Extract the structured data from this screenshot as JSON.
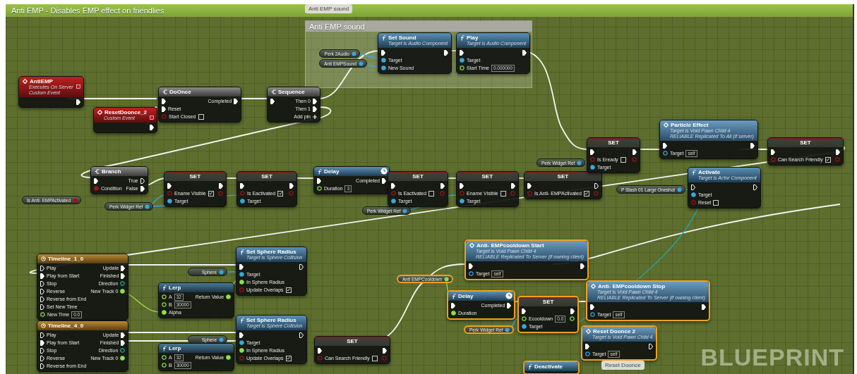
{
  "graph_comment": "Anti EMP - Disables EMP effect on friendlies",
  "bubbles": [
    {
      "text": "Anti EMP sound"
    },
    {
      "text": "Reset Doonce"
    }
  ],
  "comments": [
    {
      "title": "Anti EMP sound"
    }
  ],
  "nodes": [
    {
      "kind": "event",
      "title": "AntiEMP",
      "subtitle": [
        "Executes On Server",
        "Custom Event"
      ],
      "selected": false,
      "outputs": [
        {
          "kind": "exec",
          "linked": true
        }
      ]
    },
    {
      "kind": "event",
      "title": "ResetDoonce_2",
      "subtitle": [
        "Custom Event"
      ],
      "selected": false,
      "outputs": [
        {
          "kind": "exec",
          "linked": true
        }
      ]
    },
    {
      "kind": "flow",
      "title": "DoOnce",
      "selected": false,
      "inputs": [
        {
          "kind": "exec",
          "linked": true
        },
        {
          "kind": "exec",
          "label": "Reset",
          "linked": true
        },
        {
          "kind": "bool",
          "label": "Start Closed",
          "checked": false,
          "linked": false
        }
      ],
      "outputs": [
        {
          "kind": "exec",
          "label": "Completed",
          "linked": true
        }
      ]
    },
    {
      "kind": "flow",
      "title": "Sequence",
      "selected": false,
      "inputs": [
        {
          "kind": "exec",
          "linked": true
        }
      ],
      "outputs": [
        {
          "kind": "exec",
          "label": "Then 0",
          "linked": true
        },
        {
          "kind": "exec",
          "label": "Then 1",
          "linked": true
        },
        {
          "kind": "add",
          "label": "Add pin",
          "linked": false
        }
      ]
    },
    {
      "kind": "variable",
      "title": "Perk 2Audio",
      "color": "#38a8e0",
      "selected": false
    },
    {
      "kind": "variable",
      "title": "Anti EMPSound",
      "color": "#38a8e0",
      "selected": false
    },
    {
      "kind": "function",
      "title": "Set Sound",
      "subtitle": [
        "Target is Audio Component"
      ],
      "selected": false,
      "latent": false,
      "inputs": [
        {
          "kind": "exec",
          "linked": true
        },
        {
          "kind": "object",
          "label": "Target",
          "linked": true
        },
        {
          "kind": "object",
          "label": "New Sound",
          "linked": true
        }
      ],
      "outputs": [
        {
          "kind": "exec",
          "linked": true
        }
      ]
    },
    {
      "kind": "function",
      "title": "Play",
      "subtitle": [
        "Target is Audio Component"
      ],
      "selected": false,
      "latent": false,
      "inputs": [
        {
          "kind": "exec",
          "linked": true
        },
        {
          "kind": "object",
          "label": "Target",
          "linked": true
        },
        {
          "kind": "float",
          "label": "Start Time",
          "value": "0.000000",
          "linked": false
        }
      ],
      "outputs": [
        {
          "kind": "exec",
          "linked": true
        }
      ]
    },
    {
      "kind": "variable",
      "title": "Is Anti- EMPActivated",
      "color": "#a01414",
      "selected": false
    },
    {
      "kind": "flow",
      "title": "Branch",
      "selected": false,
      "inputs": [
        {
          "kind": "exec",
          "linked": true
        },
        {
          "kind": "bool",
          "label": "Condition",
          "linked": true
        }
      ],
      "outputs": [
        {
          "kind": "exec",
          "label": "True",
          "linked": false
        },
        {
          "kind": "exec",
          "label": "False",
          "linked": true
        }
      ]
    },
    {
      "kind": "variable",
      "title": "Perk Widget Ref",
      "color": "#38a8e0",
      "selected": false
    },
    {
      "kind": "set",
      "title": "SET",
      "selected": false,
      "inputs": [
        {
          "kind": "exec",
          "linked": true
        },
        {
          "kind": "bool",
          "label": "Ename Visible",
          "checked": true,
          "linked": false
        },
        {
          "kind": "object",
          "label": "Target",
          "linked": true
        }
      ],
      "outputs": [
        {
          "kind": "exec",
          "linked": true
        },
        {
          "kind": "bool",
          "linked": false
        }
      ]
    },
    {
      "kind": "set",
      "title": "SET",
      "selected": false,
      "inputs": [
        {
          "kind": "exec",
          "linked": true
        },
        {
          "kind": "bool",
          "label": "Is Eactivated",
          "checked": true,
          "linked": false
        },
        {
          "kind": "object",
          "label": "Target",
          "linked": true
        }
      ],
      "outputs": [
        {
          "kind": "exec",
          "linked": true
        },
        {
          "kind": "bool",
          "linked": false
        }
      ]
    },
    {
      "kind": "function",
      "title": "Delay",
      "selected": false,
      "latent": true,
      "inputs": [
        {
          "kind": "exec",
          "linked": true
        },
        {
          "kind": "float",
          "label": "Duration",
          "value": "3",
          "linked": false
        }
      ],
      "outputs": [
        {
          "kind": "exec",
          "label": "Completed",
          "linked": true
        }
      ]
    },
    {
      "kind": "variable",
      "title": "Perk Widget Ref",
      "color": "#38a8e0",
      "selected": false
    },
    {
      "kind": "set",
      "title": "SET",
      "selected": false,
      "inputs": [
        {
          "kind": "exec",
          "linked": true
        },
        {
          "kind": "bool",
          "label": "Is Eactivated",
          "checked": false,
          "linked": false
        },
        {
          "kind": "object",
          "label": "Target",
          "linked": true
        }
      ],
      "outputs": [
        {
          "kind": "exec",
          "linked": true
        },
        {
          "kind": "bool",
          "linked": false
        }
      ]
    },
    {
      "kind": "set",
      "title": "SET",
      "selected": false,
      "inputs": [
        {
          "kind": "exec",
          "linked": true
        },
        {
          "kind": "bool",
          "label": "Ename Visible",
          "checked": false,
          "linked": false
        },
        {
          "kind": "object",
          "label": "Target",
          "linked": true
        }
      ],
      "outputs": [
        {
          "kind": "exec",
          "linked": true
        },
        {
          "kind": "bool",
          "linked": false
        }
      ]
    },
    {
      "kind": "variable",
      "title": "Perk Widget Ref",
      "color": "#38a8e0",
      "selected": false
    },
    {
      "kind": "set",
      "title": "SET",
      "selected": false,
      "inputs": [
        {
          "kind": "exec",
          "linked": true
        },
        {
          "kind": "bool",
          "label": "Is Anti- EMPActivated",
          "checked": true,
          "linked": false
        }
      ],
      "outputs": [
        {
          "kind": "exec",
          "linked": false
        },
        {
          "kind": "bool",
          "linked": false
        }
      ]
    },
    {
      "kind": "set",
      "title": "SET",
      "selected": false,
      "inputs": [
        {
          "kind": "exec",
          "linked": true
        },
        {
          "kind": "bool",
          "label": "Is Eready",
          "checked": false,
          "linked": false
        },
        {
          "kind": "object",
          "label": "Target",
          "linked": true
        }
      ],
      "outputs": [
        {
          "kind": "exec",
          "linked": true
        },
        {
          "kind": "bool",
          "linked": false
        }
      ]
    },
    {
      "kind": "variable",
      "title": "P Slash 01 Large Oneshot",
      "color": "#38a8e0",
      "selected": false
    },
    {
      "kind": "customcall",
      "title": "Particle Effect",
      "subtitle": [
        "Target is Void Pawn Child 4",
        "RELIABLE Replicated To All (if server)"
      ],
      "selected": false,
      "inputs": [
        {
          "kind": "exec",
          "linked": true
        },
        {
          "kind": "object",
          "label": "Target",
          "value": "self",
          "linked": false
        }
      ],
      "outputs": [
        {
          "kind": "exec",
          "linked": true
        }
      ]
    },
    {
      "kind": "function",
      "title": "Activate",
      "subtitle": [
        "Target is Actor Component"
      ],
      "selected": false,
      "latent": false,
      "inputs": [
        {
          "kind": "exec",
          "linked": false
        },
        {
          "kind": "object",
          "label": "Target",
          "linked": true
        },
        {
          "kind": "bool",
          "label": "Reset",
          "checked": false,
          "linked": false
        }
      ],
      "outputs": [
        {
          "kind": "exec",
          "linked": false
        }
      ]
    },
    {
      "kind": "set",
      "title": "SET",
      "selected": false,
      "inputs": [
        {
          "kind": "exec",
          "linked": true
        },
        {
          "kind": "bool",
          "label": "Can Search Friendly",
          "checked": true,
          "linked": false
        }
      ],
      "outputs": [
        {
          "kind": "exec",
          "linked": true
        },
        {
          "kind": "bool",
          "linked": false
        }
      ]
    },
    {
      "kind": "timeline",
      "title": "Timeline_1_0",
      "selected": false,
      "inputs": [
        {
          "kind": "exec",
          "label": "Play",
          "linked": false
        },
        {
          "kind": "exec",
          "label": "Play from Start",
          "linked": true
        },
        {
          "kind": "exec",
          "label": "Stop",
          "linked": false
        },
        {
          "kind": "exec",
          "label": "Reverse",
          "linked": false
        },
        {
          "kind": "exec",
          "label": "Reverse from End",
          "linked": false
        },
        {
          "kind": "exec",
          "label": "Set New Time",
          "linked": false
        },
        {
          "kind": "float",
          "label": "New Time",
          "value": "0.0",
          "linked": false
        }
      ],
      "outputs": [
        {
          "kind": "exec",
          "label": "Update",
          "linked": true
        },
        {
          "kind": "exec",
          "label": "Finished",
          "linked": true
        },
        {
          "kind": "enum",
          "label": "Direction",
          "linked": false
        },
        {
          "kind": "float",
          "label": "New Track 0",
          "linked": true
        }
      ]
    },
    {
      "kind": "timeline",
      "title": "Timeline_4_0",
      "selected": false,
      "inputs": [
        {
          "kind": "exec",
          "label": "Play",
          "linked": false
        },
        {
          "kind": "exec",
          "label": "Play from Start",
          "linked": true
        },
        {
          "kind": "exec",
          "label": "Stop",
          "linked": false
        },
        {
          "kind": "exec",
          "label": "Reverse",
          "linked": false
        },
        {
          "kind": "exec",
          "label": "Reverse from End",
          "linked": false
        }
      ],
      "outputs": [
        {
          "kind": "exec",
          "label": "Update",
          "linked": true
        },
        {
          "kind": "exec",
          "label": "Finished",
          "linked": true
        },
        {
          "kind": "enum",
          "label": "Direction",
          "linked": false
        },
        {
          "kind": "float",
          "label": "New Track 0",
          "linked": true
        }
      ]
    },
    {
      "kind": "variable",
      "title": "Sphere",
      "color": "#38a8e0",
      "selected": false
    },
    {
      "kind": "pure",
      "title": "Lerp",
      "selected": false,
      "inputs": [
        {
          "kind": "float",
          "label": "A",
          "value": "32",
          "linked": false
        },
        {
          "kind": "float",
          "label": "B",
          "value": "30000",
          "linked": false
        },
        {
          "kind": "float",
          "label": "Alpha",
          "linked": true
        }
      ],
      "outputs": [
        {
          "kind": "float",
          "label": "Return Value",
          "linked": true
        }
      ]
    },
    {
      "kind": "variable",
      "title": "Sphere",
      "color": "#38a8e0",
      "selected": false
    },
    {
      "kind": "pure",
      "title": "Lerp",
      "selected": false,
      "inputs": [
        {
          "kind": "float",
          "label": "A",
          "value": "32",
          "linked": false
        },
        {
          "kind": "float",
          "label": "B",
          "value": "30000",
          "linked": false
        }
      ],
      "outputs": [
        {
          "kind": "float",
          "label": "Return Value",
          "linked": true
        }
      ]
    },
    {
      "kind": "function",
      "title": "Set Sphere Radius",
      "subtitle": [
        "Target is Sphere Collision"
      ],
      "selected": false,
      "latent": false,
      "inputs": [
        {
          "kind": "exec",
          "linked": true
        },
        {
          "kind": "object",
          "label": "Target",
          "linked": true
        },
        {
          "kind": "float",
          "label": "In Sphere Radius",
          "linked": true
        },
        {
          "kind": "bool",
          "label": "Update Overlaps",
          "checked": true,
          "linked": false
        }
      ],
      "outputs": [
        {
          "kind": "exec",
          "linked": false
        }
      ]
    },
    {
      "kind": "function",
      "title": "Set Sphere Radius",
      "subtitle": [
        "Target is Sphere Collision"
      ],
      "selected": false,
      "latent": false,
      "inputs": [
        {
          "kind": "exec",
          "linked": true
        },
        {
          "kind": "object",
          "label": "Target",
          "linked": true
        },
        {
          "kind": "float",
          "label": "In Sphere Radius",
          "linked": true
        },
        {
          "kind": "bool",
          "label": "Update Overlaps",
          "checked": true,
          "linked": false
        }
      ],
      "outputs": [
        {
          "kind": "exec",
          "linked": false
        }
      ]
    },
    {
      "kind": "set",
      "title": "SET",
      "selected": false,
      "inputs": [
        {
          "kind": "exec",
          "linked": true
        },
        {
          "kind": "bool",
          "label": "Can Search Friendly",
          "checked": false,
          "linked": false
        }
      ],
      "outputs": [
        {
          "kind": "exec",
          "linked": true
        },
        {
          "kind": "bool",
          "linked": false
        }
      ]
    },
    {
      "kind": "variable",
      "title": "Anti EMPCooldown",
      "color": "#8ee04a",
      "selected": true
    },
    {
      "kind": "customcall",
      "title": "Anti- EMPcooldown Start",
      "subtitle": [
        "Target is Void Pawn Child 4",
        "RELIABLE Replicated To Server (if owning client)"
      ],
      "selected": true,
      "inputs": [
        {
          "kind": "exec",
          "linked": true
        },
        {
          "kind": "object",
          "label": "Target",
          "value": "self",
          "linked": false
        }
      ],
      "outputs": [
        {
          "kind": "exec",
          "linked": true
        }
      ]
    },
    {
      "kind": "function",
      "title": "Delay",
      "selected": true,
      "latent": true,
      "inputs": [
        {
          "kind": "exec",
          "linked": true
        },
        {
          "kind": "float",
          "label": "Duration",
          "linked": true
        }
      ],
      "outputs": [
        {
          "kind": "exec",
          "label": "Completed",
          "linked": true
        }
      ]
    },
    {
      "kind": "set",
      "title": "SET",
      "selected": true,
      "inputs": [
        {
          "kind": "exec",
          "linked": true
        },
        {
          "kind": "float",
          "label": "Ecooldown",
          "value": "0.0",
          "linked": false
        },
        {
          "kind": "object",
          "label": "Target",
          "linked": true
        }
      ],
      "outputs": [
        {
          "kind": "exec",
          "linked": true
        },
        {
          "kind": "float",
          "linked": false
        }
      ]
    },
    {
      "kind": "customcall",
      "title": "Anti- EMPcooldown Stop",
      "subtitle": [
        "Target is Void Pawn Child 4",
        "RELIABLE Replicated To Server (if owning client)"
      ],
      "selected": true,
      "inputs": [
        {
          "kind": "exec",
          "linked": true
        },
        {
          "kind": "object",
          "label": "Target",
          "value": "self",
          "linked": false
        }
      ],
      "outputs": [
        {
          "kind": "exec",
          "linked": true
        }
      ]
    },
    {
      "kind": "variable",
      "title": "Perk Widget Ref",
      "color": "#38a8e0",
      "selected": true
    },
    {
      "kind": "customcall",
      "title": "Reset Doonce 2",
      "subtitle": [
        "Target is Void Pawn Child 4"
      ],
      "selected": true,
      "inputs": [
        {
          "kind": "exec",
          "linked": true
        },
        {
          "kind": "object",
          "label": "Target",
          "value": "self",
          "linked": false
        }
      ],
      "outputs": [
        {
          "kind": "exec",
          "linked": false
        }
      ]
    },
    {
      "kind": "function",
      "title": "Deactivate",
      "selected": true,
      "latent": false
    }
  ],
  "graph_type": "BLUEPRINT"
}
